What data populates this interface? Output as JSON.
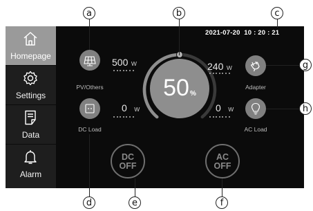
{
  "callouts": {
    "a": "a",
    "b": "b",
    "c": "c",
    "d": "d",
    "e": "e",
    "f": "f",
    "g": "g",
    "h": "h"
  },
  "status": {
    "datetime": "2021-07-20  10 : 20 : 21"
  },
  "sidebar": {
    "items": [
      {
        "label": "Homepage",
        "icon": "home-icon",
        "active": true
      },
      {
        "label": "Settings",
        "icon": "gear-icon",
        "active": false
      },
      {
        "label": "Data",
        "icon": "document-icon",
        "active": false
      },
      {
        "label": "Alarm",
        "icon": "bell-icon",
        "active": false
      }
    ]
  },
  "gauge": {
    "percent": "50",
    "percent_sign": "%",
    "level": 0.5
  },
  "inputs": {
    "pv": {
      "label": "PV/Others",
      "value": "500",
      "unit": "W",
      "icon": "solar-panel-icon"
    },
    "dc_load": {
      "label": "DC Load",
      "value": "0",
      "unit": "W",
      "icon": "dc-port-icon"
    },
    "adapter": {
      "label": "Adapter",
      "value": "240",
      "unit": "W",
      "icon": "plug-icon"
    },
    "ac_load": {
      "label": "AC Load",
      "value": "0",
      "unit": "W",
      "icon": "bulb-icon"
    }
  },
  "buttons": {
    "dc": {
      "line1": "DC",
      "line2": "OFF"
    },
    "ac": {
      "line1": "AC",
      "line2": "OFF"
    }
  },
  "colors": {
    "screen": "#0b0b0b",
    "sidebar": "#1e1e1e",
    "active_nav": "#9a9a9a",
    "icon_circle": "#808080"
  }
}
